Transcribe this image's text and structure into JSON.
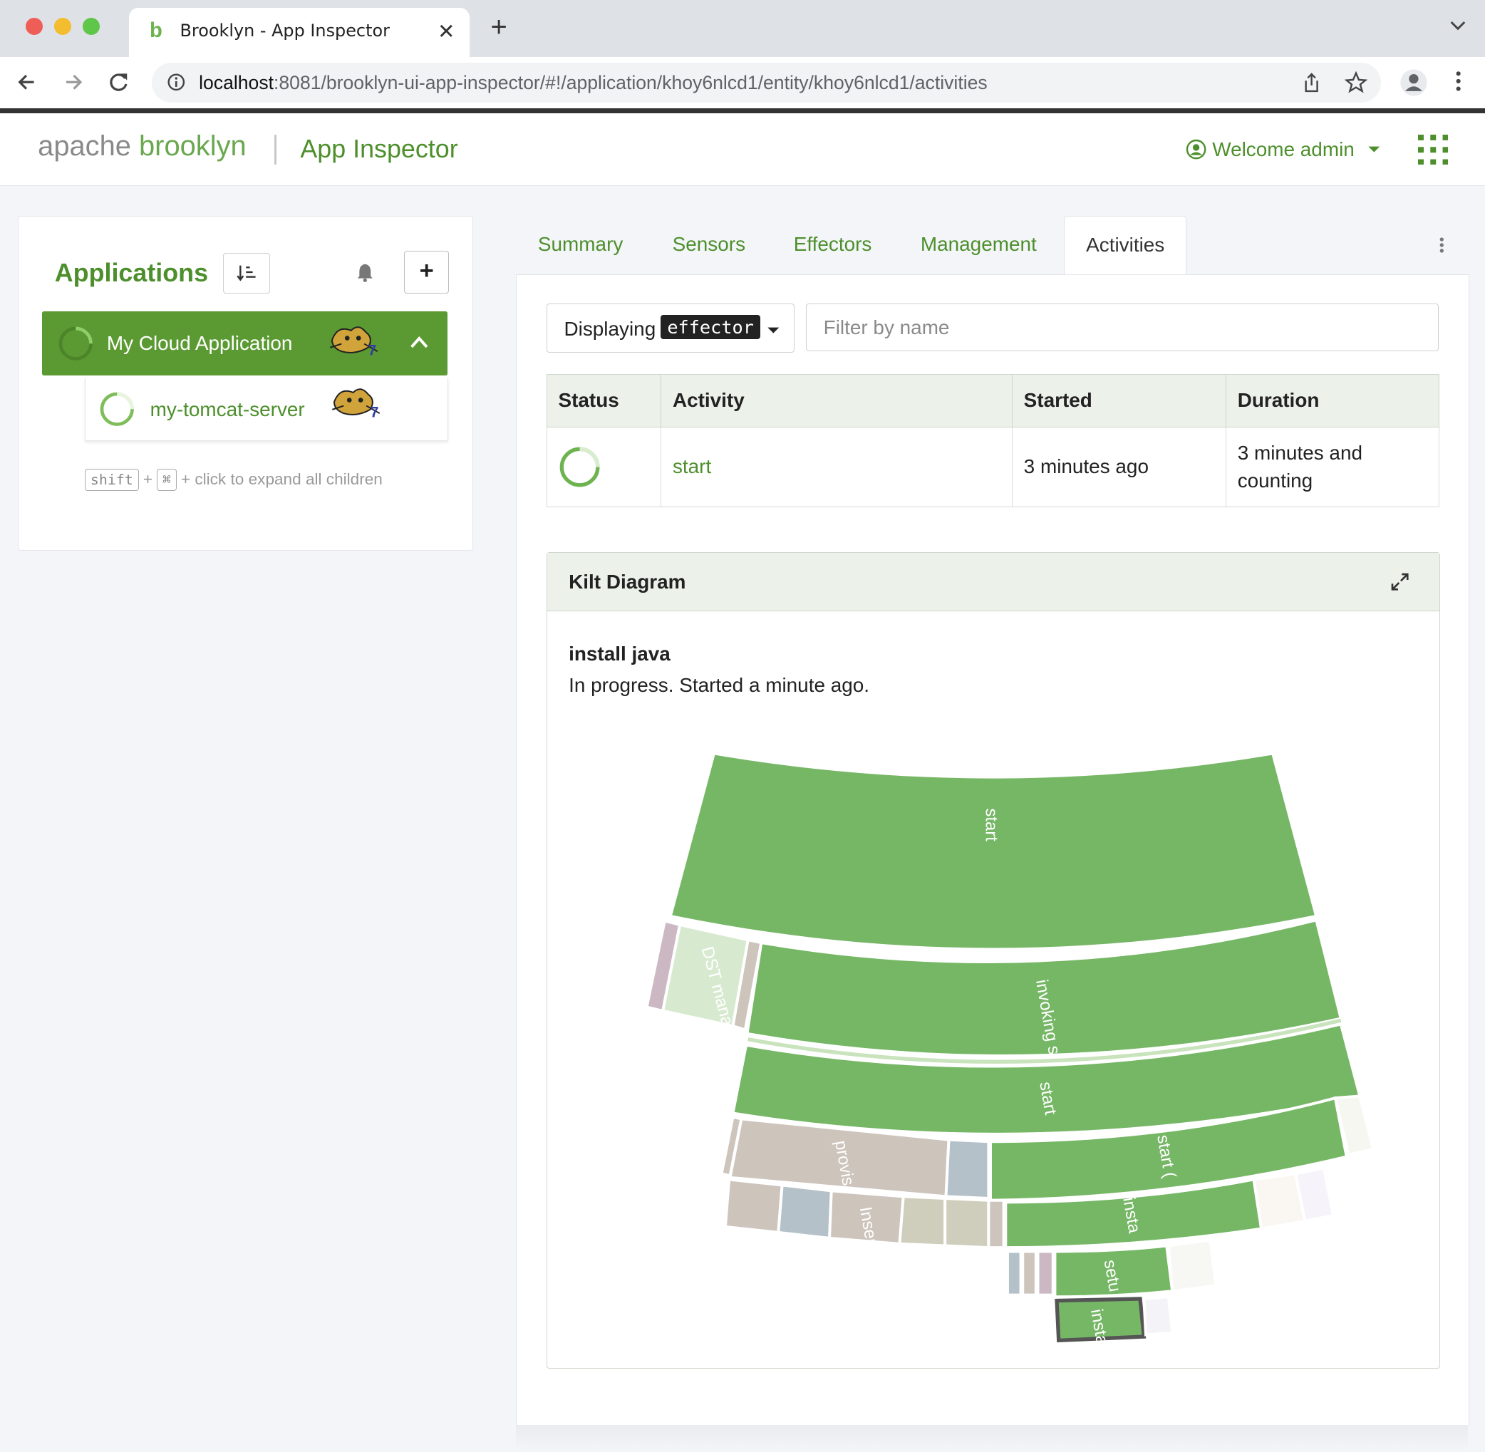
{
  "browser": {
    "tab_title": "Brooklyn - App Inspector",
    "tab_favicon": "b",
    "url_host": "localhost",
    "url_path": ":8081/brooklyn-ui-app-inspector/#!/application/khoy6nlcd1/entity/khoy6nlcd1/activities",
    "icons": [
      "back-arrow-icon",
      "forward-arrow-icon",
      "reload-icon",
      "info-icon",
      "share-icon",
      "star-icon",
      "profile-icon",
      "more-vertical-icon"
    ]
  },
  "header": {
    "logo_apache": "apache",
    "logo_brooklyn": "brooklyn",
    "app_title": "App Inspector",
    "welcome": "Welcome admin"
  },
  "sidebar": {
    "title": "Applications",
    "add_label": "+",
    "tree": [
      {
        "label": "My Cloud Application",
        "expanded": true,
        "selected": true
      },
      {
        "label": "my-tomcat-server",
        "expanded": false,
        "selected": false
      }
    ],
    "hint": {
      "key1": "shift",
      "plus": "+",
      "key2": "⌘",
      "text": "+ click to expand all children"
    }
  },
  "tabs": [
    {
      "label": "Summary",
      "active": false
    },
    {
      "label": "Sensors",
      "active": false
    },
    {
      "label": "Effectors",
      "active": false
    },
    {
      "label": "Management",
      "active": false
    },
    {
      "label": "Activities",
      "active": true
    }
  ],
  "activities": {
    "display_prefix": "Displaying",
    "display_value": "effector",
    "filter_placeholder": "Filter by name",
    "columns": [
      "Status",
      "Activity",
      "Started",
      "Duration"
    ],
    "rows": [
      {
        "status": "in-progress",
        "activity": "start",
        "started": "3 minutes ago",
        "duration": "3 minutes and counting"
      }
    ]
  },
  "kilt": {
    "title": "Kilt Diagram",
    "selected_name": "install java",
    "selected_status": "In progress. Started a minute ago.",
    "colors": {
      "active": "#76b766",
      "pale": "#d7ead0",
      "grey": "#cdc4bc",
      "blue": "#b4c1c8",
      "mauve": "#cbb8c3",
      "highlight": "#555555"
    },
    "labels": [
      "start",
      "DST mana",
      "invoking s",
      "start",
      "provis",
      "Inser",
      "start (",
      "insta",
      "setu",
      "insta"
    ]
  }
}
